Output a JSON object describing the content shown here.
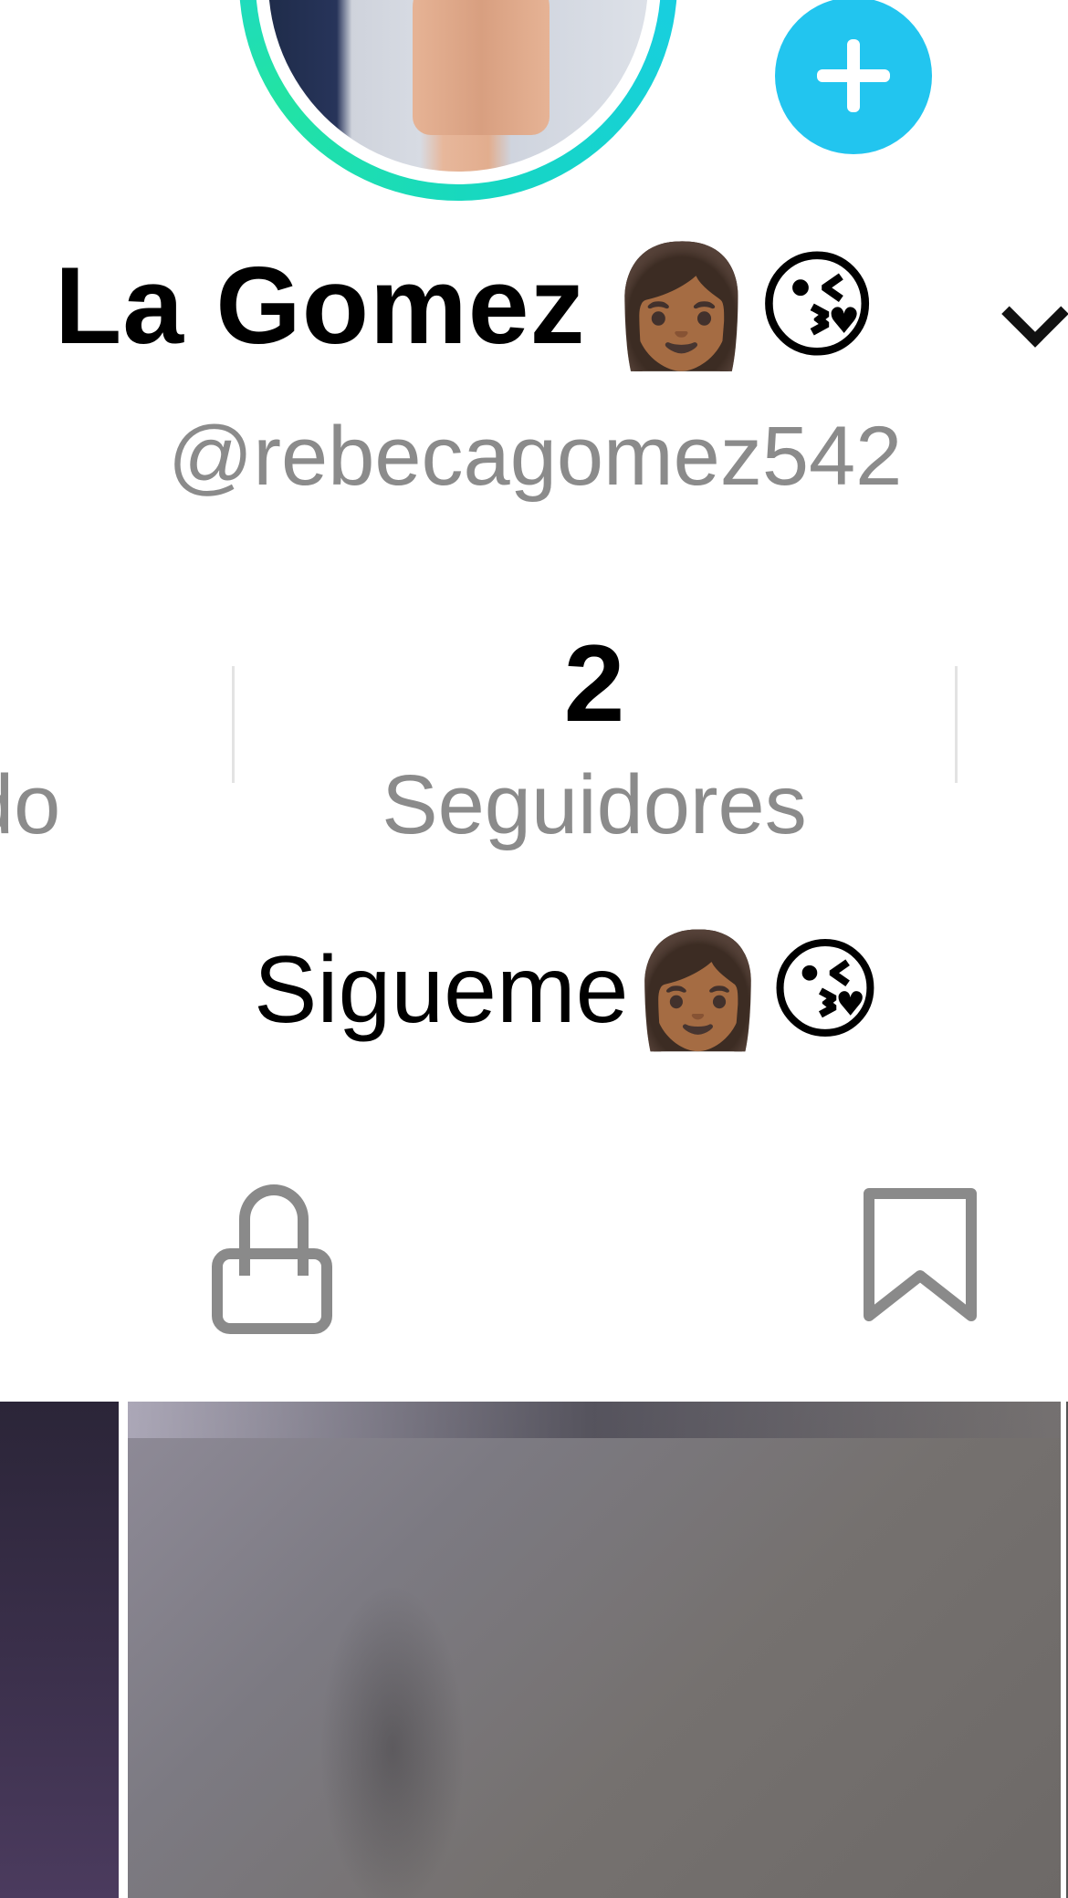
{
  "profile": {
    "display_name": "La Gomez",
    "name_emojis": "👩🏾😘",
    "username": "@rebecagomez542",
    "bio_text": "Sigueme",
    "bio_emojis": "👩🏾😘"
  },
  "stats": {
    "left_label_partial": "do",
    "followers_count": "2",
    "followers_label": "Seguidores"
  },
  "icons": {
    "add": "plus-icon",
    "dropdown": "chevron-down-icon",
    "private_tab": "lock-icon",
    "saved_tab": "bookmark-icon"
  },
  "colors": {
    "accent_blue": "#22c5ef",
    "ring_green": "#22e3a4",
    "secondary_text": "#8b8b8b",
    "icon_gray": "#8a8a8a"
  }
}
